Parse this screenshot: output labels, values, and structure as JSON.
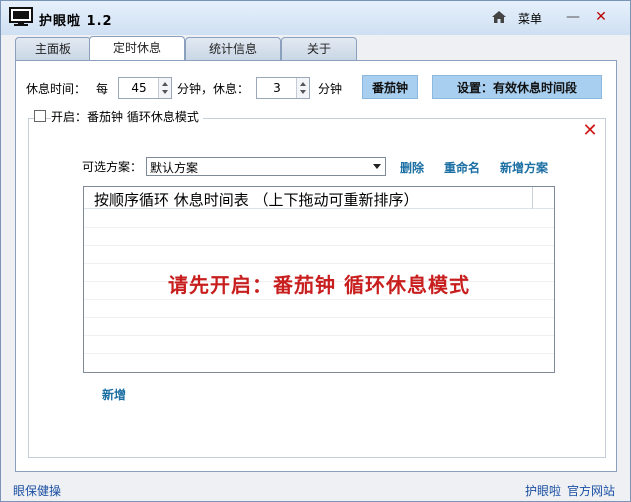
{
  "window": {
    "title": "护眼啦 1.2",
    "menu_label": "菜单",
    "minimize_glyph": "—",
    "close_glyph": "✕"
  },
  "tabs": [
    {
      "label": "主面板",
      "active": false
    },
    {
      "label": "定时休息",
      "active": true
    },
    {
      "label": "统计信息",
      "active": false
    },
    {
      "label": "关于",
      "active": false
    }
  ],
  "rest_settings": {
    "rest_time_label": "休息时间：",
    "every_label": "每",
    "interval_value": "45",
    "minutes_rest_label": "分钟，休息：",
    "rest_value": "3",
    "minutes_label": "分钟",
    "pomodoro_button": "番茄钟",
    "settings_button": "设置：有效休息时间段"
  },
  "pomodoro_mode": {
    "checkbox_label": "开启：番茄钟  循环休息模式",
    "checked": false,
    "close_glyph": "✕"
  },
  "scheme": {
    "label": "可选方案：",
    "selected": "默认方案",
    "delete_link": "删除",
    "rename_link": "重命名",
    "add_scheme_link": "新增方案"
  },
  "schedule_list": {
    "header": "按顺序循环  休息时间表  （上下拖动可重新排序）",
    "notice": "请先开启：番茄钟   循环休息模式"
  },
  "add_link": "新增",
  "statusbar": {
    "left": "眼保健操",
    "right_1": "护眼啦",
    "right_2": "官方网站"
  },
  "colors": {
    "accent_blue": "#a8cff0",
    "link_blue": "#1b6fa3",
    "notice_red": "#c81e1e",
    "close_red": "#d01818"
  }
}
